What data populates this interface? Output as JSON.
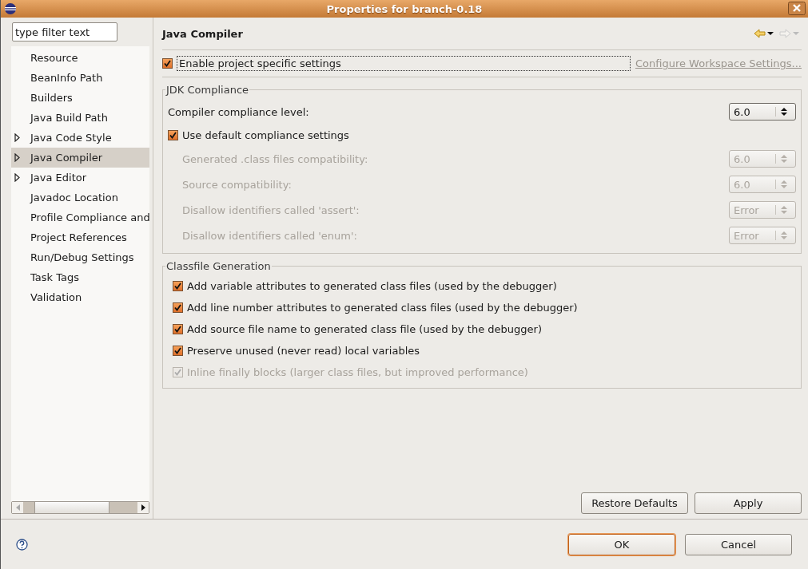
{
  "window": {
    "title": "Properties for branch-0.18"
  },
  "filter": {
    "placeholder": "type filter text"
  },
  "sidebar": {
    "items": [
      {
        "label": "Resource",
        "expandable": false,
        "selected": false
      },
      {
        "label": "BeanInfo Path",
        "expandable": false,
        "selected": false
      },
      {
        "label": "Builders",
        "expandable": false,
        "selected": false
      },
      {
        "label": "Java Build Path",
        "expandable": false,
        "selected": false
      },
      {
        "label": "Java Code Style",
        "expandable": true,
        "selected": false
      },
      {
        "label": "Java Compiler",
        "expandable": true,
        "selected": true
      },
      {
        "label": "Java Editor",
        "expandable": true,
        "selected": false
      },
      {
        "label": "Javadoc Location",
        "expandable": false,
        "selected": false
      },
      {
        "label": "Profile Compliance and",
        "expandable": false,
        "selected": false
      },
      {
        "label": "Project References",
        "expandable": false,
        "selected": false
      },
      {
        "label": "Run/Debug Settings",
        "expandable": false,
        "selected": false
      },
      {
        "label": "Task Tags",
        "expandable": false,
        "selected": false
      },
      {
        "label": "Validation",
        "expandable": false,
        "selected": false
      }
    ]
  },
  "page": {
    "title": "Java Compiler",
    "enable": {
      "label": "Enable project specific settings",
      "checked": true
    },
    "workspace_link": "Configure Workspace Settings...",
    "groups": [
      {
        "title": "JDK Compliance",
        "rows": [
          {
            "kind": "spinner",
            "label": "Compiler compliance level:",
            "value": "6.0",
            "disabled": false
          },
          {
            "kind": "checkbox",
            "label": "Use default compliance settings",
            "checked": true,
            "disabled": false
          },
          {
            "kind": "spinner",
            "label": "Generated .class files compatibility:",
            "value": "6.0",
            "disabled": true
          },
          {
            "kind": "spinner",
            "label": "Source compatibility:",
            "value": "6.0",
            "disabled": true
          },
          {
            "kind": "spinner",
            "label": "Disallow identifiers called 'assert':",
            "value": "Error",
            "disabled": true
          },
          {
            "kind": "spinner",
            "label": "Disallow identifiers called 'enum':",
            "value": "Error",
            "disabled": true
          }
        ]
      },
      {
        "title": "Classfile Generation",
        "rows": [
          {
            "kind": "checkbox",
            "label": "Add variable attributes to generated class files (used by the debugger)",
            "checked": true,
            "disabled": false
          },
          {
            "kind": "checkbox",
            "label": "Add line number attributes to generated class files (used by the debugger)",
            "checked": true,
            "disabled": false
          },
          {
            "kind": "checkbox",
            "label": "Add source file name to generated class file (used by the debugger)",
            "checked": true,
            "disabled": false
          },
          {
            "kind": "checkbox",
            "label": "Preserve unused (never read) local variables",
            "checked": true,
            "disabled": false
          },
          {
            "kind": "checkbox",
            "label": "Inline finally blocks (larger class files, but improved performance)",
            "checked": true,
            "disabled": true
          }
        ]
      }
    ],
    "buttons": [
      "Restore Defaults",
      "Apply"
    ]
  },
  "footer": {
    "buttons": [
      "OK",
      "Cancel"
    ]
  }
}
